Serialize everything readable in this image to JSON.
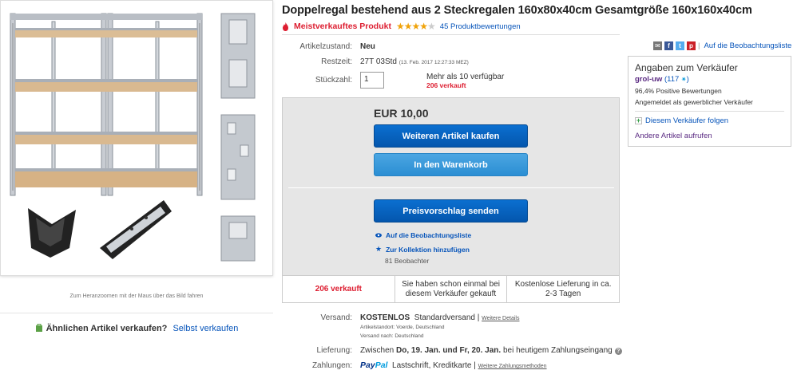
{
  "title": "Doppelregal bestehend aus 2 Steckregalen 160x80x40cm Gesamtgröße 160x160x40cm",
  "badge": "Meistverkauftes Produkt",
  "rating": {
    "stars": 3.5,
    "count_label": "45 Produktbewertungen"
  },
  "details": {
    "condition_label": "Artikelzustand:",
    "condition_value": "Neu",
    "time_label": "Restzeit:",
    "time_value": "27T 03Std",
    "time_detail": "(13. Feb. 2017   12:27:33 MEZ)",
    "qty_label": "Stückzahl:",
    "qty_value": "1",
    "available": "Mehr als 10 verfügbar",
    "sold": "206 verkauft"
  },
  "buy": {
    "price": "EUR 10,00",
    "buy_now": "Weiteren Artikel kaufen",
    "add_to_cart": "In den Warenkorb",
    "make_offer": "Preisvorschlag senden",
    "watch": "Auf die Beobachtungsliste",
    "collection": "Zur Kollektion hinzufügen",
    "watchers": "81 Beobachter"
  },
  "infobar": {
    "sold": "206 verkauft",
    "bought_before": "Sie haben schon einmal bei diesem Verkäufer gekauft",
    "delivery": "Kostenlose Lieferung in ca. 2-3 Tagen"
  },
  "shipping": {
    "label": "Versand:",
    "cost": "KOSTENLOS",
    "method": "Standardversand |",
    "more": "Weitere Details",
    "location": "Artikelstandort:  Voerde, Deutschland",
    "ships_to": "Versand nach:  Deutschland",
    "delivery_label": "Lieferung:",
    "delivery_prefix": "Zwischen",
    "delivery_range": "Do, 19. Jan. und Fr, 20. Jan.",
    "delivery_suffix": "bei heutigem Zahlungseingang",
    "payment_label": "Zahlungen:",
    "paypal_1": "Pay",
    "paypal_2": "Pal",
    "pay_methods": "Lastschrift,  Kreditkarte  |",
    "more_payments": "Weitere Zahlungsmethoden"
  },
  "share": {
    "watchlist": "Auf die Beobachtungsliste"
  },
  "seller": {
    "heading": "Angaben zum Verkäufer",
    "name": "grol-uw",
    "feedback": "(117",
    "feedback_close": ")",
    "positive": "96,4% Positive Bewertungen",
    "registered": "Angemeldet als gewerblicher Verkäufer",
    "follow": "Diesem Verkäufer folgen",
    "other_items": "Andere Artikel aufrufen"
  },
  "left": {
    "zoom_hint": "Zum Heranzoomen mit der Maus über das Bild fahren",
    "sell_q": "Ähnlichen Artikel verkaufen?",
    "sell_link": "Selbst verkaufen"
  }
}
